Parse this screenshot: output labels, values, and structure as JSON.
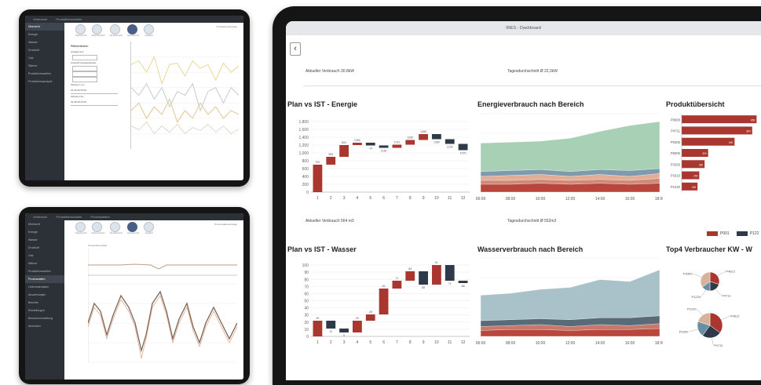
{
  "small_tablet_top": {
    "topbar_items": [
      "Verbrauch",
      "Produktionszahlen"
    ],
    "right_title": "Produktionsanzeige",
    "sidebar": [
      "Übersicht",
      "Energie",
      "Wasser",
      "Druckluft",
      "Gas",
      "Wärme",
      "Produktionszahlen",
      "Produktionsanalyse"
    ],
    "toolbar_icons": [
      "Tagesansicht",
      "Wochenansicht",
      "Monatsansicht",
      "Jahresansicht",
      "Vergleich"
    ],
    "filter": {
      "title": "Filterkriterien",
      "rows": [
        "Anlage/Linie",
        "Auswahl Ausgangsbasis",
        "Zeitraum von",
        "Zeitraum bis"
      ],
      "date_from": "01.08.16 00:00",
      "date_to": "31.08.16 23:59"
    }
  },
  "small_tablet_bottom": {
    "topbar_items": [
      "Verbrauch",
      "Produktionszahlen",
      "Prozessdaten"
    ],
    "right_title": "Prozessdatenanzeige",
    "sidebar": [
      "Übersicht",
      "Energie",
      "Wasser",
      "Druckluft",
      "Gas",
      "Wärme",
      "Produktionszahlen",
      "Prozessdaten",
      "Lieferantendaten",
      "Auswertungen",
      "Berichte",
      "Einstellungen",
      "Benutzerverwaltung",
      "Abmelden"
    ],
    "toolbar_icons": [
      "Tagesansicht",
      "Wochenansicht",
      "Monatsansicht",
      "Jahresansicht",
      "Vergleich"
    ],
    "chart_caption": "Temperaturverlauf"
  },
  "dashboard": {
    "title": "IRES - Dashboard",
    "back_icon": "chevron-left-icon",
    "energy_kpi_left": "Aktueller Verbrauch 30.8kW",
    "energy_kpi_right": "Tagesdurchschnitt Ø 22,3kW",
    "water_kpi_left": "Aktueller Verbrauch 564 m3",
    "water_kpi_right": "Tagesdurchschnitt Ø 552m3",
    "panels": {
      "plan_energie": "Plan vs IST - Energie",
      "energie_bereich": "Energieverbrauch nach Bereich",
      "produkt": "Produktübersicht",
      "plan_wasser": "Plan vs IST - Wasser",
      "wasser_bereich": "Wasserverbrauch nach Bereich",
      "top4": "Top4 Verbraucher KW - W"
    },
    "legend": [
      {
        "label": "P001",
        "color": "#a9362f"
      },
      {
        "label": "P122",
        "color": "#2e3a4a"
      }
    ]
  },
  "chart_data": [
    {
      "type": "bar",
      "subtype": "waterfall",
      "title": "Plan vs IST - Energie",
      "categories": [
        "1",
        "2",
        "3",
        "4",
        "5",
        "6",
        "7",
        "8",
        "9",
        "10",
        "11",
        "12"
      ],
      "values": [
        700,
        200,
        300,
        60,
        -70,
        -60,
        80,
        120,
        150,
        -130,
        -120,
        -160
      ],
      "data_labels": [
        "700",
        "",
        "800",
        "",
        "-70",
        "",
        "",
        "",
        "",
        "",
        "",
        ""
      ],
      "ylim": [
        0,
        2000
      ],
      "yticks": [
        "0",
        "200",
        "400",
        "600",
        "800",
        "1,000",
        "1,200",
        "1,400",
        "1,600",
        "1,800"
      ],
      "colors": {
        "positive": "#a9362f",
        "negative": "#2e3a4a"
      }
    },
    {
      "type": "area",
      "title": "Energieverbrauch nach Bereich",
      "x": [
        "06:00",
        "08:00",
        "10:00",
        "12:00",
        "14:00",
        "16:00",
        "18:00"
      ],
      "series": [
        {
          "values": [
            8,
            8,
            9,
            8,
            9,
            8,
            9
          ],
          "color": "#b8463c"
        },
        {
          "values": [
            12,
            12,
            13,
            12,
            13,
            12,
            14
          ],
          "color": "#cf8b77"
        },
        {
          "values": [
            16,
            17,
            18,
            16,
            18,
            16,
            19
          ],
          "color": "#e3ad93"
        },
        {
          "values": [
            21,
            22,
            23,
            21,
            23,
            22,
            24
          ],
          "color": "#7e9aac"
        },
        {
          "values": [
            50,
            51,
            52,
            55,
            62,
            68,
            72
          ],
          "color": "#a8d0b5"
        }
      ]
    },
    {
      "type": "bar",
      "orientation": "horizontal",
      "title": "Produktübersicht",
      "categories": [
        "P0600",
        "P4711",
        "P0300",
        "P5000",
        "P3250",
        "P3310",
        "P1220"
      ],
      "values": [
        850,
        800,
        600,
        300,
        260,
        200,
        180
      ],
      "color": "#a9362f"
    },
    {
      "type": "bar",
      "subtype": "waterfall",
      "title": "Plan vs IST - Wasser",
      "categories": [
        "1",
        "2",
        "3",
        "4",
        "5",
        "6",
        "7",
        "8",
        "9",
        "10",
        "11",
        "12"
      ],
      "values": [
        20,
        -10,
        -5,
        15,
        8,
        33,
        10,
        12,
        -17,
        25,
        -20,
        -3
      ],
      "data_labels": [
        "",
        "",
        "",
        "",
        "",
        "",
        "",
        "",
        "",
        "",
        "",
        ""
      ],
      "ylim": [
        0,
        100
      ],
      "yticks": [
        "0",
        "10",
        "20",
        "30",
        "40",
        "50",
        "60",
        "70",
        "80",
        "90",
        "100"
      ],
      "colors": {
        "positive": "#a9362f",
        "negative": "#2e3a4a"
      }
    },
    {
      "type": "area",
      "title": "Wasserverbrauch nach Bereich",
      "x": [
        "06:00",
        "08:00",
        "10:00",
        "12:00",
        "14:00",
        "16:00",
        "18:00"
      ],
      "series": [
        {
          "values": [
            6,
            7,
            7,
            6,
            7,
            7,
            8
          ],
          "color": "#b8463c"
        },
        {
          "values": [
            10,
            11,
            12,
            10,
            12,
            11,
            13
          ],
          "color": "#c9776b"
        },
        {
          "values": [
            16,
            17,
            18,
            17,
            19,
            19,
            21
          ],
          "color": "#5a6b78"
        },
        {
          "values": [
            42,
            44,
            48,
            50,
            58,
            56,
            68
          ],
          "color": "#a9c2c9"
        }
      ]
    },
    {
      "type": "pie",
      "title": "Top4 Verbraucher KW - W",
      "pies": [
        {
          "labels": [
            "P4612",
            "P4711",
            "P1220",
            "P0300"
          ],
          "values": [
            30,
            20,
            15,
            35
          ]
        },
        {
          "labels": [
            "P4612",
            "P4711",
            "P0300",
            "P1220"
          ],
          "values": [
            35,
            25,
            20,
            20
          ]
        }
      ],
      "colors": [
        "#a9362f",
        "#2e3a4a",
        "#6a8fa5",
        "#d6b29a"
      ]
    }
  ]
}
